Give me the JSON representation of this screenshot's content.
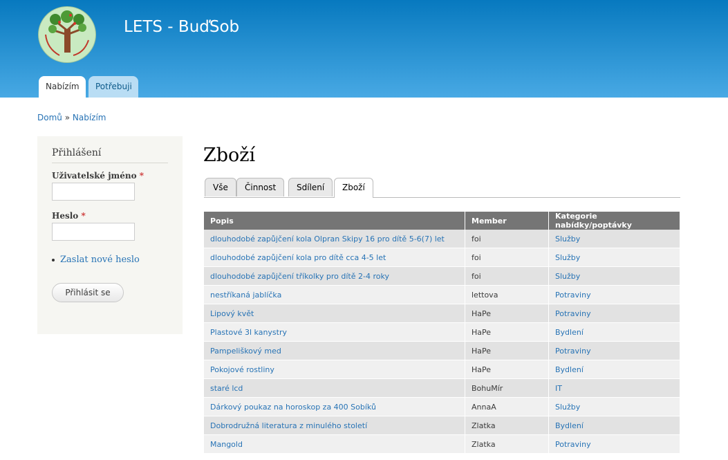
{
  "header": {
    "site_name": "LETS - BuďSob",
    "tabs": [
      {
        "label": "Nabízím",
        "active": true
      },
      {
        "label": "Potřebuji",
        "active": false
      }
    ]
  },
  "breadcrumb": {
    "home": "Domů",
    "separator": "»",
    "current": "Nabízím"
  },
  "sidebar": {
    "title": "Přihlášení",
    "username_label": "Uživatelské jméno",
    "password_label": "Heslo",
    "required_mark": "*",
    "forgot_link": "Zaslat nové heslo",
    "login_button": "Přihlásit se"
  },
  "main": {
    "title": "Zboží",
    "tabs": [
      {
        "label": "Vše"
      },
      {
        "label": "Činnost"
      },
      {
        "label": "Sdílení"
      },
      {
        "label": "Zboží",
        "active": true
      }
    ],
    "table": {
      "headers": [
        "Popis",
        "Member",
        "Kategorie nabídky/poptávky"
      ],
      "rows": [
        [
          "dlouhodobé zapůjčení kola Olpran Skipy 16 pro dítě 5-6(7) let",
          "foi",
          "Služby"
        ],
        [
          "dlouhodobé zapůjčení kola pro dítě cca 4-5 let",
          "foi",
          "Služby"
        ],
        [
          "dlouhodobé zapůjčení tříkolky pro dítě 2-4 roky",
          "foi",
          "Služby"
        ],
        [
          "nestříkaná jablíčka",
          "lettova",
          "Potraviny"
        ],
        [
          "Lipový květ",
          "HaPe",
          "Potraviny"
        ],
        [
          "Plastové 3l kanystry",
          "HaPe",
          "Bydlení"
        ],
        [
          "Pampeliškový med",
          "HaPe",
          "Potraviny"
        ],
        [
          "Pokojové rostliny",
          "HaPe",
          "Bydlení"
        ],
        [
          "staré lcd",
          "BohuMír",
          "IT"
        ],
        [
          "Dárkový poukaz na horoskop za 400 Sobíků",
          "AnnaA",
          "Služby"
        ],
        [
          "Dobrodružná literatura z minulého století",
          "Zlatka",
          "Bydlení"
        ],
        [
          "Mangold",
          "Zlatka",
          "Potraviny"
        ]
      ]
    }
  },
  "colors": {
    "header_top": "#0779bf",
    "header_bottom": "#48a9e4",
    "link": "#2773b5",
    "table_header": "#757575"
  }
}
